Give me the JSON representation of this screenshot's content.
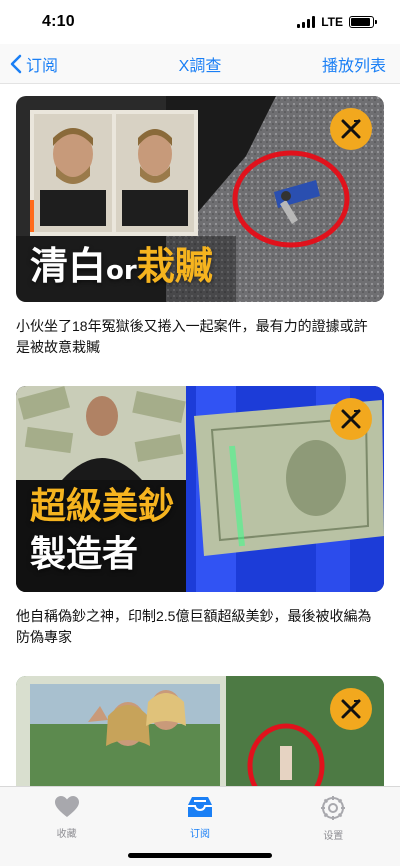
{
  "status_bar": {
    "time": "4:10",
    "network": "LTE"
  },
  "nav": {
    "back_label": "订阅",
    "title": "X調查",
    "right_label": "播放列表"
  },
  "colors": {
    "accent": "#1a7ff5",
    "badge": "#f2a81e"
  },
  "episodes": [
    {
      "thumb_text_1": "清白",
      "thumb_text_or": "or",
      "thumb_text_2": "栽贓",
      "title": "小伙坐了18年冤獄後又捲入一起案件，最有力的證據或許是被故意栽贓"
    },
    {
      "thumb_text_1": "超級美鈔",
      "thumb_text_2": "製造者",
      "title": "他自稱偽鈔之神，印制2.5億巨額超級美鈔，最後被收編為防偽專家"
    },
    {
      "title": ""
    }
  ],
  "tab_bar": {
    "items": [
      {
        "label": "收藏",
        "icon": "heart-icon",
        "active": false
      },
      {
        "label": "订阅",
        "icon": "inbox-tray-icon",
        "active": true
      },
      {
        "label": "设置",
        "icon": "gear-icon",
        "active": false
      }
    ]
  }
}
